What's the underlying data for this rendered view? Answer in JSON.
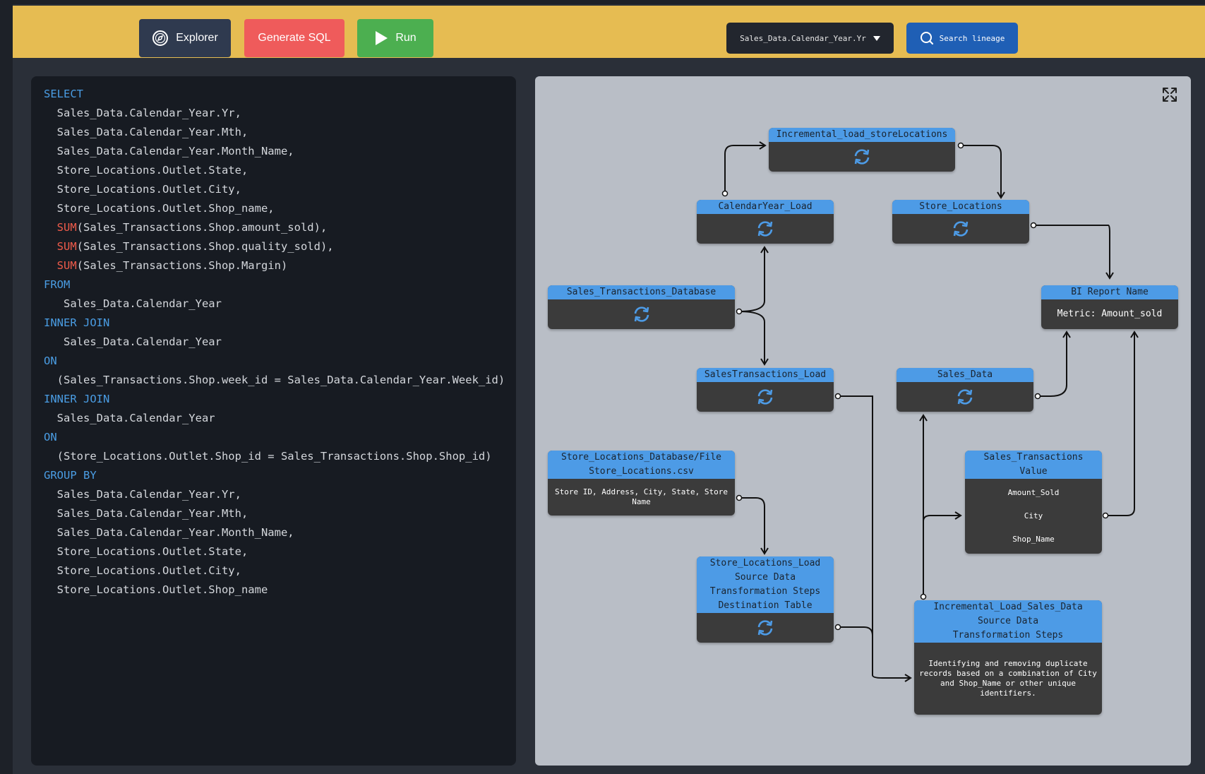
{
  "toolbar": {
    "explorer_label": "Explorer",
    "generate_label": "Generate SQL",
    "run_label": "Run",
    "column_selected": "Sales_Data.Calendar_Year.Yr",
    "search_label": "Search lineage",
    "background_color": "#e6bc52"
  },
  "sql": {
    "lines": [
      {
        "kw": "SELECT"
      },
      {
        "text": "  Sales_Data.Calendar_Year.Yr,"
      },
      {
        "text": "  Sales_Data.Calendar_Year.Mth,"
      },
      {
        "text": "  Sales_Data.Calendar_Year.Month_Name,"
      },
      {
        "text": "  Store_Locations.Outlet.State,"
      },
      {
        "text": "  Store_Locations.Outlet.City,"
      },
      {
        "text": "  Store_Locations.Outlet.Shop_name,"
      },
      {
        "fn": "  SUM",
        "text": "(Sales_Transactions.Shop.amount_sold),"
      },
      {
        "fn": "  SUM",
        "text": "(Sales_Transactions.Shop.quality_sold),"
      },
      {
        "fn": "  SUM",
        "text": "(Sales_Transactions.Shop.Margin)"
      },
      {
        "kw": "FROM"
      },
      {
        "text": "   Sales_Data.Calendar_Year"
      },
      {
        "kw": "INNER JOIN"
      },
      {
        "text": "   Sales_Data.Calendar_Year"
      },
      {
        "kw": "ON"
      },
      {
        "text": "  (Sales_Transactions.Shop.week_id = Sales_Data.Calendar_Year.Week_id)"
      },
      {
        "kw": "INNER JOIN"
      },
      {
        "text": "  Sales_Data.Calendar_Year"
      },
      {
        "kw": "ON"
      },
      {
        "text": "  (Store_Locations.Outlet.Shop_id = Sales_Transactions.Shop.Shop_id)"
      },
      {
        "kw": "GROUP BY"
      },
      {
        "text": "  Sales_Data.Calendar_Year.Yr,"
      },
      {
        "text": "  Sales_Data.Calendar_Year.Mth,"
      },
      {
        "text": "  Sales_Data.Calendar_Year.Month_Name,"
      },
      {
        "text": "  Store_Locations.Outlet.State,"
      },
      {
        "text": "  Store_Locations.Outlet.City,"
      },
      {
        "text": "  Store_Locations.Outlet.Shop_name"
      }
    ]
  },
  "lineage": {
    "nodes": {
      "incremental_store": {
        "title": "Incremental_load_storeLocations"
      },
      "calendar_load": {
        "title": "CalendarYear_Load"
      },
      "store_locations": {
        "title": "Store_Locations"
      },
      "bi_report": {
        "title": "BI Report Name",
        "body": "Metric: Amount_sold"
      },
      "sales_db": {
        "title": "Sales_Transactions_Database"
      },
      "sales_tx_load": {
        "title": "SalesTransactions_Load"
      },
      "sales_data": {
        "title": "Sales_Data"
      },
      "store_db": {
        "title": "Store_Locations_Database/File",
        "subtitle": "Store_Locations.csv",
        "body": "Store ID, Address, City, State, Store Name"
      },
      "sales_tx_value": {
        "title": "Sales_Transactions",
        "subtitle": "Value",
        "fields": [
          "Amount_Sold",
          "City",
          "Shop_Name"
        ]
      },
      "store_loc_load": {
        "title": "Store_Locations_Load",
        "rows": [
          "Source Data",
          "Transformation Steps",
          "Destination Table"
        ]
      },
      "incremental_sales": {
        "title": "Incremental_Load_Sales_Data",
        "rows": [
          "Source Data",
          "Transformation Steps"
        ],
        "body": "Identifying and removing duplicate records based on a combination of City and Shop_Name or other unique identifiers."
      }
    }
  }
}
